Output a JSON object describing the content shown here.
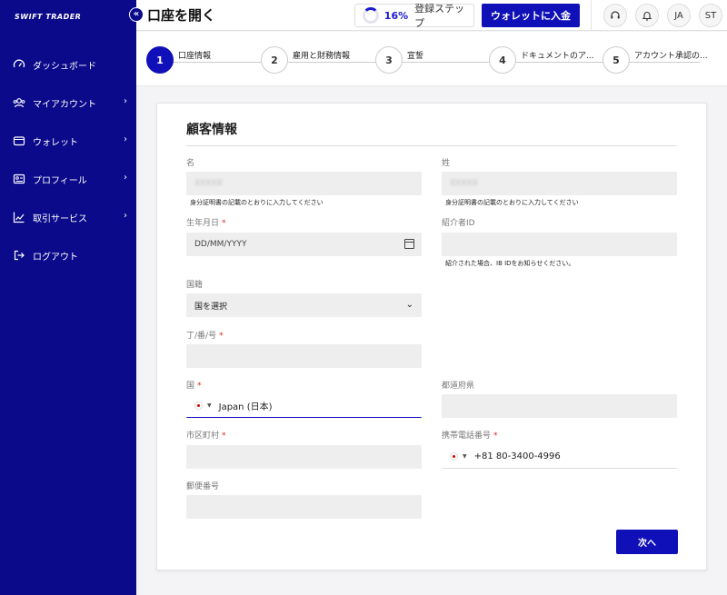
{
  "sidebar": {
    "logo": "SWIFT TRADER",
    "items": [
      {
        "label": "ダッシュボード",
        "icon": "dashboard-icon",
        "has_submenu": false
      },
      {
        "label": "マイアカウント",
        "icon": "users-icon",
        "has_submenu": true
      },
      {
        "label": "ウォレット",
        "icon": "wallet-icon",
        "has_submenu": true
      },
      {
        "label": "プロフィール",
        "icon": "id-card-icon",
        "has_submenu": true
      },
      {
        "label": "取引サービス",
        "icon": "chart-line-icon",
        "has_submenu": true
      },
      {
        "label": "ログアウト",
        "icon": "logout-icon",
        "has_submenu": false
      }
    ]
  },
  "header": {
    "title": "口座を開く",
    "progress_pct": "16%",
    "progress_value": 0.16,
    "progress_label": "登録ステップ",
    "deposit_label": "ウォレットに入金",
    "lang_label": "JA",
    "avatar_label": "ST"
  },
  "stepper": {
    "steps": [
      {
        "num": "1",
        "label": "口座情報",
        "active": true
      },
      {
        "num": "2",
        "label": "雇用と財務情報",
        "active": false
      },
      {
        "num": "3",
        "label": "宣誓",
        "active": false
      },
      {
        "num": "4",
        "label": "ドキュメントのア...",
        "active": false
      },
      {
        "num": "5",
        "label": "アカウント承認の...",
        "active": false
      }
    ]
  },
  "form": {
    "title": "顧客情報",
    "first_name_label": "名",
    "first_name_value": "XXXXX",
    "first_name_hint": "身分証明書の記載のとおりに入力してください",
    "last_name_label": "姓",
    "last_name_value": "XXXXX",
    "last_name_hint": "身分証明書の記載のとおりに入力してください",
    "dob_label": "生年月日",
    "dob_placeholder": "DD/MM/YYYY",
    "referrer_label": "紹介者ID",
    "referrer_hint": "紹介された場合、IB IDをお知らせください。",
    "nationality_label": "国籍",
    "nationality_value": "国を選択",
    "address_label": "丁/番/号",
    "country_label": "国",
    "country_value": "Japan (日本)",
    "prefecture_label": "都道府県",
    "city_label": "市区町村",
    "phone_label": "携帯電話番号",
    "phone_value": "+81 80-3400-4996",
    "postal_label": "郵便番号",
    "required_mark": "*",
    "next_label": "次へ"
  },
  "colors": {
    "sidebar_bg": "#0a0a8a",
    "accent": "#1010b8",
    "required": "#dd2222"
  }
}
